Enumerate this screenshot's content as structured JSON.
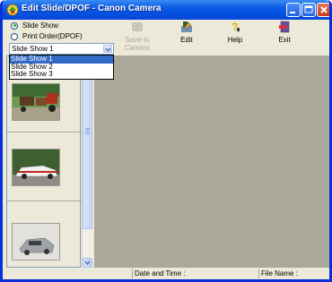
{
  "window": {
    "title": "Edit Slide/DPOF  - Canon Camera"
  },
  "mode": {
    "options": [
      {
        "label": "Slide Show",
        "selected": true
      },
      {
        "label": "Print Order(DPOF)",
        "selected": false
      }
    ]
  },
  "toolbar": {
    "save_label_line1": "Save to",
    "save_label_line2": "Camera",
    "edit_label": "Edit",
    "help_label": "Help",
    "exit_label": "Exit"
  },
  "slideshow_select": {
    "value": "Slide Show 1",
    "options": [
      "Slide Show 1",
      "Slide Show 2",
      "Slide Show 3"
    ]
  },
  "statusbar": {
    "datetime_label": "Date and Time :",
    "filename_label": "File Name :"
  },
  "colors": {
    "titlebar": "#0a5ae6",
    "selection": "#316ac5",
    "preview_bg": "#aca899",
    "window_bg": "#ece9d8"
  }
}
